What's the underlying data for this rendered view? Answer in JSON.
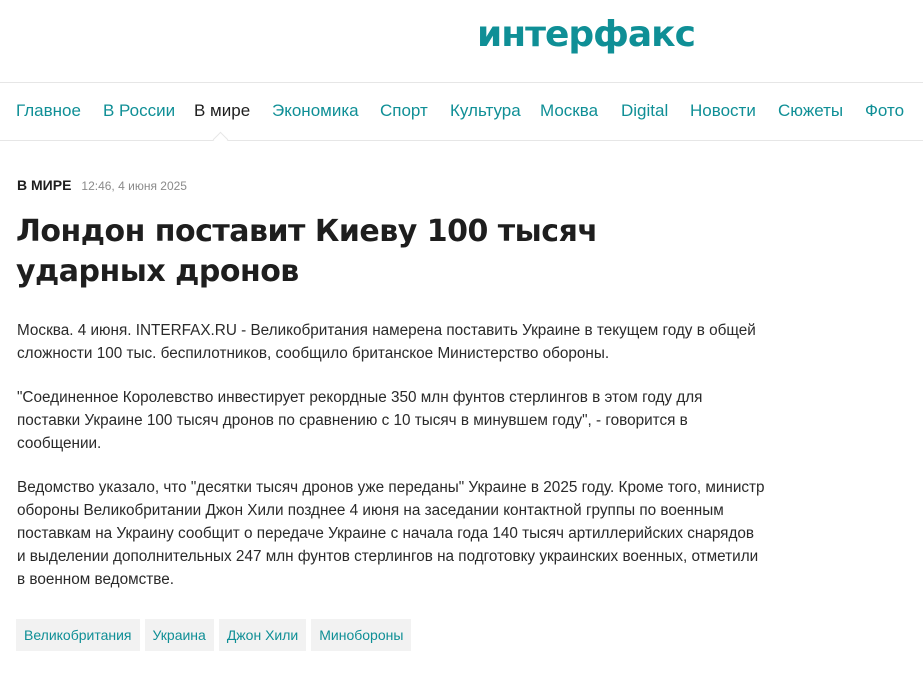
{
  "header": {
    "logo_text": "интерфакс"
  },
  "nav": {
    "items": [
      {
        "label": "Главное",
        "active": false
      },
      {
        "label": "В России",
        "active": false
      },
      {
        "label": "В мире",
        "active": true
      },
      {
        "label": "Экономика",
        "active": false
      },
      {
        "label": "Спорт",
        "active": false
      },
      {
        "label": "Культура",
        "active": false
      },
      {
        "label": "Москва",
        "active": false
      },
      {
        "label": "Digital",
        "active": false
      },
      {
        "label": "Новости",
        "active": false
      },
      {
        "label": "Сюжеты",
        "active": false
      },
      {
        "label": "Фото",
        "active": false
      }
    ]
  },
  "article": {
    "rubric": "В МИРЕ",
    "date": "12:46, 4 июня 2025",
    "title": "Лондон поставит Киеву 100 тысяч ударных дронов",
    "paragraphs": [
      "Москва. 4 июня. INTERFAX.RU - Великобритания намерена поставить Украине в текущем году в общей сложности 100 тыс. беспилотников, сообщило британское Министерство обороны.",
      "\"Соединенное Королевство инвестирует рекордные 350 млн фунтов стерлингов в этом году для поставки Украине 100 тысяч дронов по сравнению с 10 тысяч в минувшем году\", - говорится в сообщении.",
      "Ведомство указало, что \"десятки тысяч дронов уже переданы\" Украине в 2025 году. Кроме того, министр обороны Великобритании Джон Хили позднее 4 июня на заседании контактной группы по военным поставкам на Украину сообщит о передаче Украине с начала года 140 тысяч артиллерийских снарядов и выделении дополнительных 247 млн фунтов стерлингов на подготовку украинских военных, отметили в военном ведомстве."
    ],
    "tags": [
      "Великобритания",
      "Украина",
      "Джон Хили",
      "Минобороны"
    ]
  },
  "colors": {
    "brand": "#0f8f96",
    "text": "#1e1e1e",
    "muted": "#8a8a8a",
    "tag_bg": "#f2f2f2",
    "divider": "#e6e6e6"
  }
}
